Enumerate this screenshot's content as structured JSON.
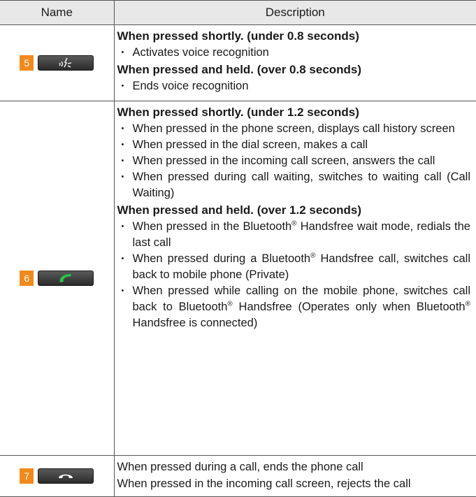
{
  "header": {
    "name": "Name",
    "description": "Description"
  },
  "rows": [
    {
      "number": "5",
      "key_icon": "voice-recognition-icon",
      "short_title": "When pressed shortly. (under 0.8 seconds)",
      "short_items": [
        "Activates voice recognition"
      ],
      "held_title": "When pressed and held. (over 0.8 seconds)",
      "held_items": [
        "Ends voice recognition"
      ]
    },
    {
      "number": "6",
      "key_icon": "call-icon",
      "short_title": "When pressed shortly. (under 1.2 seconds)",
      "short_items": [
        "When pressed in the phone screen, displays call history screen",
        "When pressed in the dial screen, makes a call",
        "When pressed in the incoming call screen, answers the call",
        "When pressed during call waiting, switches to waiting call (Call Waiting)"
      ],
      "held_title": "When pressed and held. (over 1.2 seconds)",
      "held_items": [
        {
          "pre": "When pressed in the Bluetooth",
          "sup": "®",
          "post": " Handsfree wait mode, redials the last call"
        },
        {
          "pre": "When pressed during a Bluetooth",
          "sup": "®",
          "post": " Handsfree call, switches call back to mobile phone (Private)"
        },
        {
          "pre": "When pressed while calling on the mobile phone, switches call back to Bluetooth",
          "sup": "®",
          "post": " Handsfree (Operates only when Bluetooth",
          "sup2": "®",
          "post2": " Handsfree is connected)"
        }
      ]
    },
    {
      "number": "7",
      "key_icon": "end-call-icon",
      "lines": [
        "When pressed during a call, ends the phone call",
        "When pressed in the incoming call screen, rejects the call"
      ]
    }
  ],
  "colors": {
    "number_badge": "#f08a1c",
    "call_icon": "#27c34a",
    "header_bg": "#e8e8e8"
  }
}
